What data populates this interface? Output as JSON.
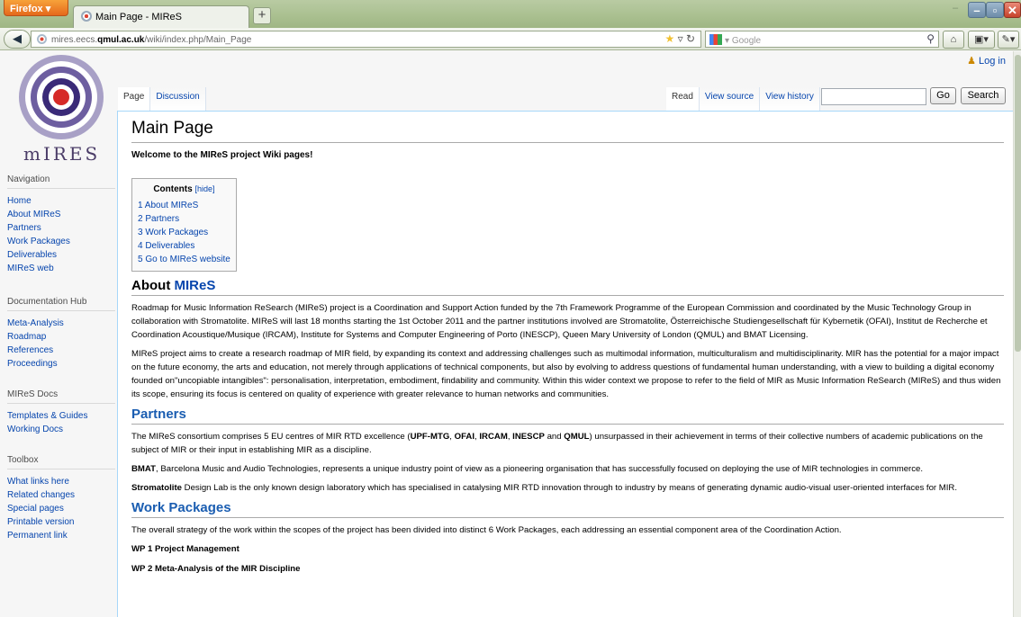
{
  "browser": {
    "menu_button": "Firefox",
    "tab_title": "Main Page - MIReS",
    "new_tab": "+",
    "url_prefix": "mires.eecs.",
    "url_host": "qmul.ac.uk",
    "url_path": "/wiki/index.php/Main_Page",
    "search_engine": "Google",
    "icons": [
      "firefox-menu-icon",
      "back-arrow-icon",
      "bookmark-star-icon",
      "reload-icon",
      "search-icon",
      "home-icon",
      "bookmarks-icon",
      "addon-icon"
    ]
  },
  "wiki": {
    "login": "Log in",
    "logo_text": "mIRES",
    "tabs_left": [
      "Page",
      "Discussion"
    ],
    "tabs_right": [
      "Read",
      "View source",
      "View history"
    ],
    "go_button": "Go",
    "search_button": "Search",
    "sidebar": {
      "navigation": {
        "heading": "Navigation",
        "items": [
          "Home",
          "About MIReS",
          "Partners",
          "Work Packages",
          "Deliverables",
          "MIReS web"
        ]
      },
      "documentation": {
        "heading": "Documentation Hub",
        "items": [
          "Meta-Analysis",
          "Roadmap",
          "References",
          "Proceedings"
        ]
      },
      "docs": {
        "heading": "MIReS Docs",
        "items": [
          "Templates & Guides",
          "Working Docs"
        ]
      },
      "toolbox": {
        "heading": "Toolbox",
        "items": [
          "What links here",
          "Related changes",
          "Special pages",
          "Printable version",
          "Permanent link"
        ]
      }
    },
    "title": "Main Page",
    "welcome": "Welcome to the MIReS project Wiki pages!",
    "toc": {
      "title": "Contents",
      "hide": "[hide]",
      "items": [
        "1 About MIReS",
        "2 Partners",
        "3 Work Packages",
        "4 Deliverables",
        "5 Go to MIReS website"
      ]
    },
    "about": {
      "heading_prefix": "About ",
      "heading_link": "MIReS",
      "p1": "Roadmap for Music Information ReSearch (MIReS) project is a Coordination and Support Action funded by the 7th Framework Programme of the European Commission and coordinated by the Music Technology Group in collaboration with Stromatolite. MIReS will last 18 months starting the 1st October 2011 and the partner institutions involved are Stromatolite, Österreichische Studiengesellschaft für Kybernetik (OFAI), Institut de Recherche et Coordination Acoustique/Musique (IRCAM), Institute for Systems and Computer Engineering of Porto (INESCP), Queen Mary University of London (QMUL) and BMAT Licensing.",
      "p2": "MIReS project aims to create a research roadmap of MIR field, by expanding its context and addressing challenges such as multimodal information, multiculturalism and multidisciplinarity. MIR has the potential for a major impact on the future economy, the arts and education, not merely through applications of technical components, but also by evolving to address questions of fundamental human understanding, with a view to building a digital economy founded on\"uncopiable intangibles\": personalisation, interpretation, embodiment, findability and community. Within this wider context we propose to refer to the field of MIR as Music Information ReSearch (MIReS) and thus widen its scope, ensuring its focus is centered on quality of experience with greater relevance to human networks and communities."
    },
    "partners": {
      "heading": "Partners",
      "p1_a": "The MIReS consortium comprises 5 EU centres of MIR RTD excellence (",
      "p1_b": "UPF-MTG",
      "p1_c": ", ",
      "p1_d": "OFAI",
      "p1_e": ", ",
      "p1_f": "IRCAM",
      "p1_g": ", ",
      "p1_h": "INESCP",
      "p1_i": " and ",
      "p1_j": "QMUL",
      "p1_k": ") unsurpassed in their achievement in terms of their collective numbers of academic publications on the subject of MIR or their input in establishing MIR as a discipline.",
      "p2_bold": "BMAT",
      "p2_rest": ", Barcelona Music and Audio Technologies, represents a unique industry point of view as a pioneering organisation that has successfully focused on deploying the use of MIR technologies in commerce.",
      "p3_bold": "Stromatolite",
      "p3_rest": " Design Lab is the only known design laboratory which has specialised in catalysing MIR RTD innovation through to industry by means of generating dynamic audio-visual user-oriented interfaces for MIR."
    },
    "work_packages": {
      "heading": "Work Packages",
      "intro": "The overall strategy of the work within the scopes of the project has been divided into distinct 6 Work Packages, each addressing an essential component area of the Coordination Action.",
      "wp1": "WP 1 Project Management",
      "wp2": "WP 2 Meta-Analysis of the MIR Discipline"
    }
  }
}
